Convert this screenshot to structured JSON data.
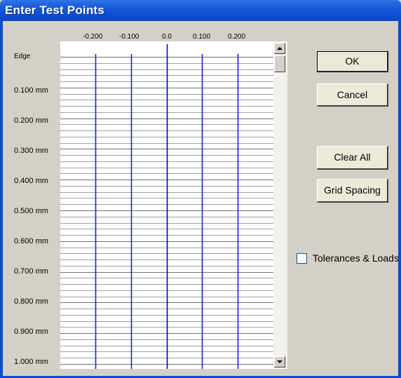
{
  "window": {
    "title": "Enter Test Points"
  },
  "grid": {
    "column_labels": [
      "-0.200",
      "-0.100",
      "0.0",
      "0.100",
      "0.200"
    ],
    "row_labels": [
      "Edge",
      "0.100 mm",
      "0.200 mm",
      "0.300 mm",
      "0.400 mm",
      "0.500 mm",
      "0.600 mm",
      "0.700 mm",
      "0.800 mm",
      "0.900 mm",
      "1.000 mm"
    ],
    "center_line_color": "#0000cc",
    "line_color": "#2020d8",
    "row_line_color": "#a0a0a0"
  },
  "buttons": {
    "ok": "OK",
    "cancel": "Cancel",
    "clear_all": "Clear All",
    "grid_spacing": "Grid Spacing"
  },
  "options": {
    "tolerances_loads": {
      "label": "Tolerances & Loads",
      "checked": false
    }
  }
}
